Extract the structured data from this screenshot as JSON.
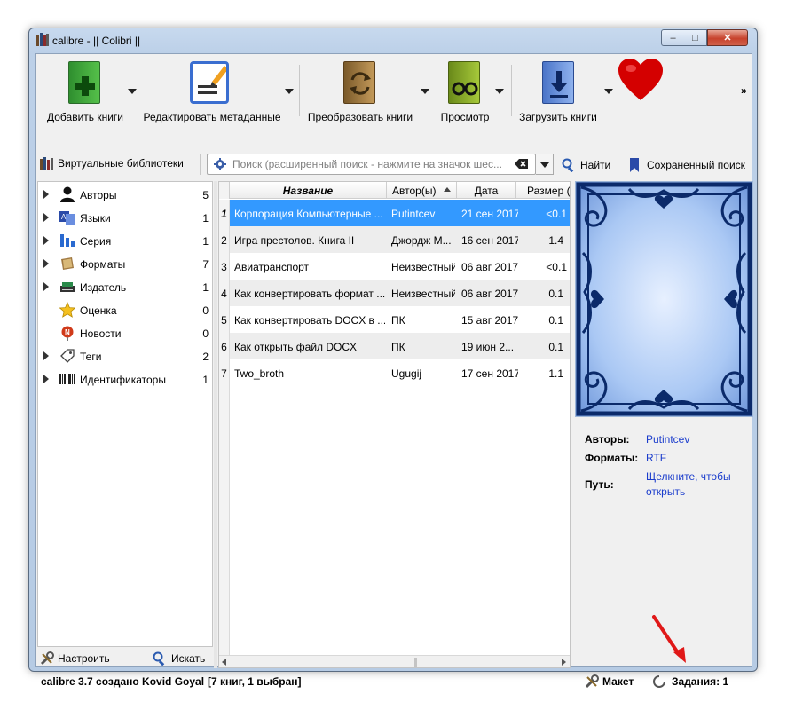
{
  "window": {
    "title": "calibre - || Colibri ||",
    "minimize": "–",
    "maximize": "□",
    "close": "✕"
  },
  "toolbar": {
    "add": "Добавить книги",
    "edit": "Редактировать метаданные",
    "convert": "Преобразовать книги",
    "view": "Просмотр",
    "download": "Загрузить книги",
    "more": "»"
  },
  "search": {
    "virtual_libs": "Виртуальные библиотеки",
    "placeholder": "Поиск (расширенный поиск - нажмите на значок шес...",
    "find": "Найти",
    "saved": "Сохраненный поиск"
  },
  "tag_browser": [
    {
      "label": "Авторы",
      "count": "5",
      "icon": "person-icon",
      "expand": true
    },
    {
      "label": "Языки",
      "count": "1",
      "icon": "language-icon",
      "expand": true
    },
    {
      "label": "Серия",
      "count": "1",
      "icon": "series-icon",
      "expand": true
    },
    {
      "label": "Форматы",
      "count": "7",
      "icon": "book-icon",
      "expand": true
    },
    {
      "label": "Издатель",
      "count": "1",
      "icon": "publisher-icon",
      "expand": true
    },
    {
      "label": "Оценка",
      "count": "0",
      "icon": "star-icon",
      "expand": false
    },
    {
      "label": "Новости",
      "count": "0",
      "icon": "news-icon",
      "expand": false
    },
    {
      "label": "Теги",
      "count": "2",
      "icon": "tag-icon",
      "expand": true
    },
    {
      "label": "Идентификаторы",
      "count": "1",
      "icon": "barcode-icon",
      "expand": true
    }
  ],
  "tag_footer": {
    "configure": "Настроить",
    "find": "Искать"
  },
  "table": {
    "columns": [
      "Название",
      "Автор(ы)",
      "Дата",
      "Размер (M"
    ],
    "rows": [
      {
        "num": "1",
        "title": "Корпорация Компьютерные ...",
        "author": "Putintcev",
        "date": "21 сен 2017",
        "size": "<0.1"
      },
      {
        "num": "2",
        "title": "Игра престолов. Книга II",
        "author": "Джордж М...",
        "date": "16 сен 2017",
        "size": "1.4"
      },
      {
        "num": "3",
        "title": "Авиатранспорт",
        "author": "Неизвестный",
        "date": "06 авг 2017",
        "size": "<0.1"
      },
      {
        "num": "4",
        "title": "Как конвертировать формат ...",
        "author": "Неизвестный",
        "date": "06 авг 2017",
        "size": "0.1"
      },
      {
        "num": "5",
        "title": "Как конвертировать DOCX в ...",
        "author": "ПК",
        "date": "15 авг 2017",
        "size": "0.1"
      },
      {
        "num": "6",
        "title": "Как открыть файл DOCX",
        "author": "ПК",
        "date": "19 июн 2...",
        "size": "0.1"
      },
      {
        "num": "7",
        "title": "Two_broth",
        "author": "Ugugij",
        "date": "17 сен 2017",
        "size": "1.1"
      }
    ]
  },
  "details": {
    "authors_k": "Авторы:",
    "authors_v": "Putintcev",
    "formats_k": "Форматы:",
    "formats_v": "RTF",
    "path_k": "Путь:",
    "path_v1": "Щелкните, чтобы",
    "path_v2": "открыть"
  },
  "status": {
    "left": "calibre 3.7 создано Kovid Goyal",
    "count": "[7 книг, 1 выбран]",
    "layout": "Макет",
    "jobs": "Задания: 1"
  },
  "colors": {
    "selection": "#3399ff",
    "link": "#1a3ccc"
  }
}
